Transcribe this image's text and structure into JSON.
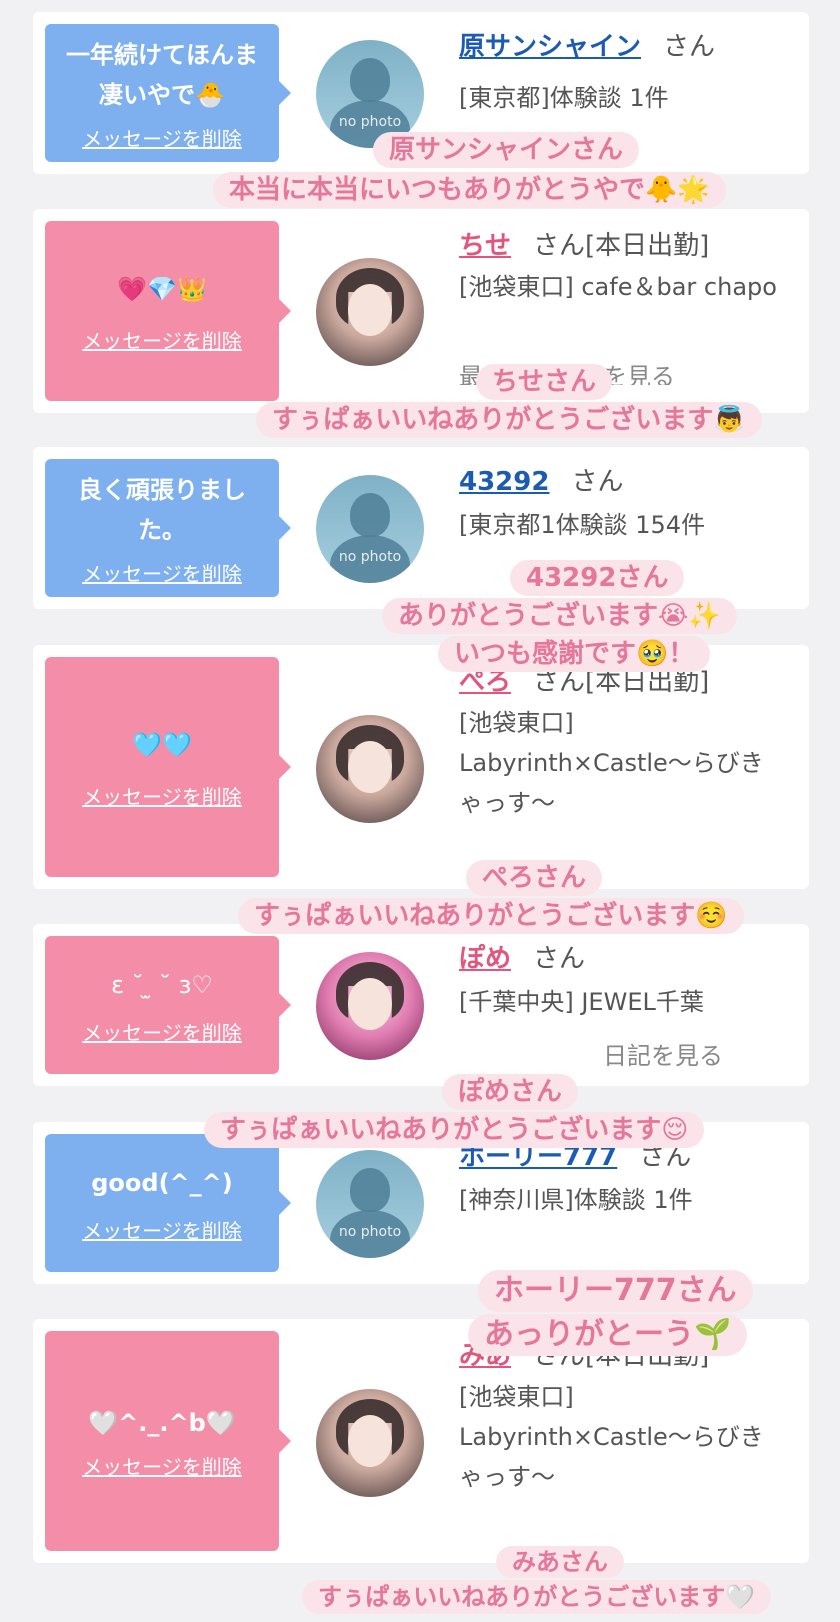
{
  "cards": [
    {
      "message": "一年続けてほんま凄いやで🐣",
      "delete_label": "メッセージを削除",
      "name": "原サンシャイン",
      "honorific": "さん",
      "sub": "[東京都]体験談 1件",
      "avatar": "no photo",
      "overlay_name": "原サンシャインさん",
      "overlay_text": "本当に本当にいつもありがとうやで🐥🌟"
    },
    {
      "message": "💗💎👑",
      "delete_label": "メッセージを削除",
      "name": "ちせ",
      "honorific": "さん[本日出勤]",
      "sub": "[池袋東口] cafe＆bar chapo",
      "sub_hidden": "最新の体験談を見る",
      "avatar": "photo",
      "overlay_name": "ちせさん",
      "overlay_text": "すぅぱぁいいねありがとうございます👼"
    },
    {
      "message": "良く頑張りました。",
      "delete_label": "メッセージを削除",
      "name": "43292",
      "honorific": "さん",
      "sub": "[東京都1体験談 154件",
      "avatar": "no photo",
      "overlay_name": "43292さん",
      "overlay_text": "ありがとうございます😭✨",
      "overlay_text2": "いつも感謝です🥹！"
    },
    {
      "message": "🩵🩵",
      "delete_label": "メッセージを削除",
      "name": "ぺろ",
      "honorific": "さん[本日出勤]",
      "sub": "[池袋東口] Labyrinth×Castle〜らびきゃっす〜",
      "avatar": "photo",
      "overlay_name": "ぺろさん",
      "overlay_text": "すぅぱぁいいねありがとうございます☺️"
    },
    {
      "message": "ɛ ˘ ̫ ˘ ɜ♡",
      "delete_label": "メッセージを削除",
      "name": "ぽめ",
      "honorific": "さん",
      "sub": "[千葉中央] JEWEL千葉",
      "sub_hidden": "日記を見る",
      "avatar": "photo",
      "overlay_name": "ぽめさん",
      "overlay_text": "すぅぱぁいいねありがとうございます😌"
    },
    {
      "message": "good(^_^)",
      "delete_label": "メッセージを削除",
      "name": "ホーリー777",
      "honorific": "さん",
      "sub": "[神奈川県]体験談 1件",
      "avatar": "no photo",
      "overlay_name": "ホーリー777さん",
      "overlay_text": "あっりがとーう🌱"
    },
    {
      "message": "🤍^._.^b🤍",
      "delete_label": "メッセージを削除",
      "name": "みあ",
      "honorific": "さん[本日出勤]",
      "sub": "[池袋東口] Labyrinth×Castle〜らびきゃっす〜",
      "avatar": "photo",
      "overlay_name": "みあさん",
      "overlay_text": "すぅぱぁいいねありがとうございます🤍"
    }
  ],
  "colors": {
    "blue_bubble": "#7eb0f0",
    "pink_bubble": "#f48ea8",
    "blue_name": "#1b5bb1",
    "pink_name": "#e2557d",
    "overlay_text": "#e4779a",
    "overlay_bg": "#fbe3ea"
  }
}
